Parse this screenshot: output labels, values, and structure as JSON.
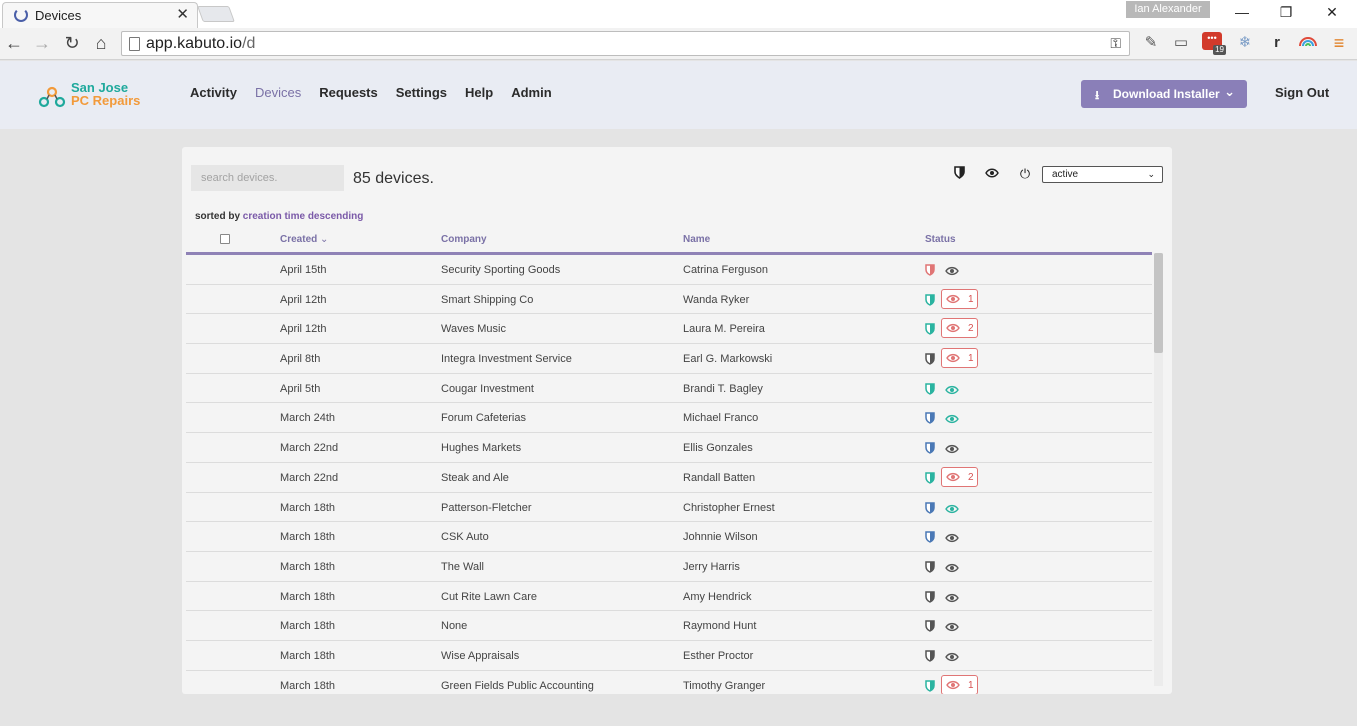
{
  "browser": {
    "tab_title": "Devices",
    "tab_close": "✕",
    "user_badge": "Ian Alexander",
    "url_host": "app.kabuto.io",
    "url_path": "/d",
    "ext_badge_count": "19",
    "ext_letter": "r"
  },
  "header": {
    "logo_line1": "San Jose",
    "logo_line2": "PC Repairs",
    "nav": [
      "Activity",
      "Devices",
      "Requests",
      "Settings",
      "Help",
      "Admin"
    ],
    "active_nav": "Devices",
    "download_label": "Download Installer",
    "signout_label": "Sign Out"
  },
  "devices": {
    "search_placeholder": "search devices.",
    "count_text": "85 devices.",
    "filter_value": "active",
    "sorted_prefix": "sorted by",
    "sorted_by": "creation time descending",
    "columns": {
      "created": "Created",
      "company": "Company",
      "name": "Name",
      "status": "Status"
    },
    "rows": [
      {
        "created": "April 15th",
        "company": "Security Sporting Goods",
        "name": "Catrina Ferguson",
        "shield": "#e07575",
        "eye": "#555555",
        "alert": null
      },
      {
        "created": "April 12th",
        "company": "Smart Shipping Co",
        "name": "Wanda Ryker",
        "shield": "#2ab3a0",
        "eye": null,
        "alert": "1"
      },
      {
        "created": "April 12th",
        "company": "Waves Music",
        "name": "Laura M. Pereira",
        "shield": "#2ab3a0",
        "eye": null,
        "alert": "2"
      },
      {
        "created": "April 8th",
        "company": "Integra Investment Service",
        "name": "Earl G. Markowski",
        "shield": "#555555",
        "eye": null,
        "alert": "1"
      },
      {
        "created": "April 5th",
        "company": "Cougar Investment",
        "name": "Brandi T. Bagley",
        "shield": "#2ab3a0",
        "eye": "#2ab3a0",
        "alert": null
      },
      {
        "created": "March 24th",
        "company": "Forum Cafeterias",
        "name": "Michael Franco",
        "shield": "#4a78b5",
        "eye": "#2ab3a0",
        "alert": null
      },
      {
        "created": "March 22nd",
        "company": "Hughes Markets",
        "name": "Ellis Gonzales",
        "shield": "#4a78b5",
        "eye": "#555555",
        "alert": null
      },
      {
        "created": "March 22nd",
        "company": "Steak and Ale",
        "name": "Randall Batten",
        "shield": "#2ab3a0",
        "eye": null,
        "alert": "2"
      },
      {
        "created": "March 18th",
        "company": "Patterson-Fletcher",
        "name": "Christopher Ernest",
        "shield": "#4a78b5",
        "eye": "#2ab3a0",
        "alert": null
      },
      {
        "created": "March 18th",
        "company": "CSK Auto",
        "name": "Johnnie Wilson",
        "shield": "#4a78b5",
        "eye": "#555555",
        "alert": null
      },
      {
        "created": "March 18th",
        "company": "The Wall",
        "name": "Jerry Harris",
        "shield": "#555555",
        "eye": "#555555",
        "alert": null
      },
      {
        "created": "March 18th",
        "company": "Cut Rite Lawn Care",
        "name": "Amy Hendrick",
        "shield": "#555555",
        "eye": "#555555",
        "alert": null
      },
      {
        "created": "March 18th",
        "company": "None",
        "name": "Raymond Hunt",
        "shield": "#555555",
        "eye": "#555555",
        "alert": null
      },
      {
        "created": "March 18th",
        "company": "Wise Appraisals",
        "name": "Esther Proctor",
        "shield": "#555555",
        "eye": "#555555",
        "alert": null
      },
      {
        "created": "March 18th",
        "company": "Green Fields Public Accounting",
        "name": "Timothy Granger",
        "shield": "#2ab3a0",
        "eye": null,
        "alert": "1"
      }
    ]
  },
  "colors": {
    "accent": "#8a7fb8",
    "logo_teal": "#1fa99c",
    "logo_orange": "#f29a3a",
    "alert_red": "#e07575"
  }
}
